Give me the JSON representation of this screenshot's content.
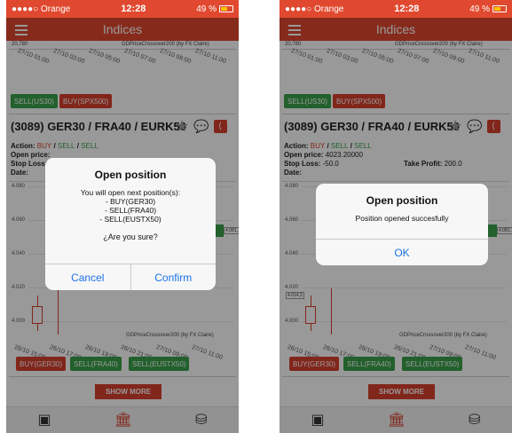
{
  "status": {
    "carrier": "●●●●○ Orange",
    "time": "12:28",
    "battery": "49 %"
  },
  "nav": {
    "title": "Indices"
  },
  "top_chart": {
    "price": "20.780",
    "source": "GDPriceCrossover200 (by FX Claire)",
    "ticks": [
      "27/10 01:00",
      "27/10 03:00",
      "27/10 05:00",
      "27/10 07:00",
      "27/10 09:00",
      "27/10 11:00"
    ]
  },
  "top_buttons": {
    "sell": "SELL(US30)",
    "buy": "BUY(SPX500)"
  },
  "signal": {
    "title": "(3089) GER30 / FRA40 / EURK50",
    "action_label": "Action:",
    "action_buy": "BUY",
    "action_sell1": "SELL",
    "action_sell2": "SELL",
    "open_price_label": "Open price:",
    "open_price": "4023.20000",
    "stop_loss_label": "Stop Loss:",
    "stop_loss": "-50.0",
    "take_profit_label": "Take Profit:",
    "take_profit": "200.0",
    "date_label": "Date:"
  },
  "big_chart": {
    "y_labels": [
      "4.080",
      "4.060",
      "4.040",
      "4.020",
      "4.000"
    ],
    "source": "GDPriceCrossover200 (by FX Claire)",
    "marker": "4.014,3",
    "right_tag": "4.081,1",
    "ticks": [
      "26/10 15:00",
      "26/10 17:00",
      "26/10 19:00",
      "26/10 21:00",
      "27/10 09:00",
      "27/10 11:00"
    ]
  },
  "bottom_buttons": {
    "buy": "BUY(GER30)",
    "sell1": "SELL(FRA40)",
    "sell2": "SELL(EUSTX50)"
  },
  "show_more": "SHOW MORE",
  "tabs": [
    "money-icon",
    "bank-icon",
    "coins-icon"
  ],
  "dialog_confirm": {
    "title": "Open position",
    "message_line1": "You will open next position(s):",
    "line1": "- BUY(GER30)",
    "line2": "- SELL(FRA40)",
    "line3": "- SELL(EUSTX50)",
    "question": "¿Are you sure?",
    "cancel": "Cancel",
    "confirm": "Confirm"
  },
  "dialog_done": {
    "title": "Open position",
    "message": "Position opened succesfully",
    "ok": "OK"
  },
  "colors": {
    "brand": "#e0492f",
    "buy": "#d8402e",
    "sell": "#3aa14a",
    "link": "#1a73e8"
  }
}
